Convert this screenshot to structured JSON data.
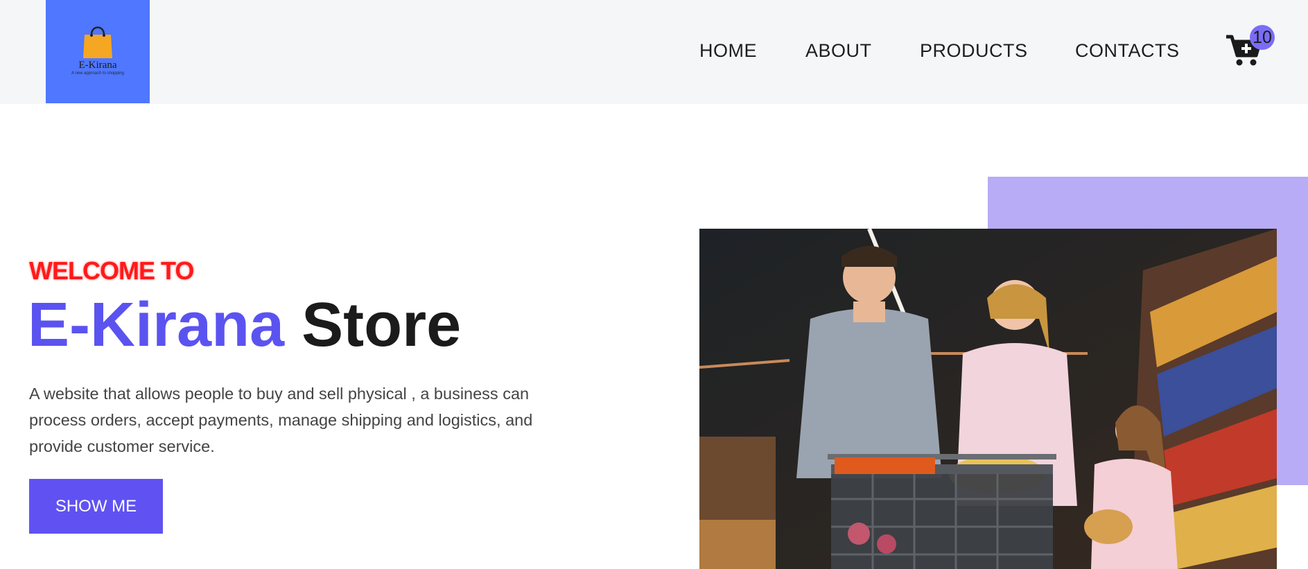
{
  "header": {
    "logo": {
      "name": "E-Kirana",
      "tagline": "A new approach to shopping",
      "bag_color": "#f5a623"
    },
    "nav": [
      {
        "label": "HOME"
      },
      {
        "label": "ABOUT"
      },
      {
        "label": "PRODUCTS"
      },
      {
        "label": "CONTACTS"
      }
    ],
    "cart": {
      "icon": "cart-plus-icon",
      "count": "10"
    }
  },
  "hero": {
    "welcome": "WELCOME TO",
    "title_brand": "E-Kirana",
    "title_rest": "Store",
    "description": "A website that allows people to buy and sell physical , a business can process orders, accept payments, manage shipping and logistics, and provide customer service.",
    "button_label": "SHOW ME"
  },
  "colors": {
    "accent": "#6052f2",
    "brand_text": "#5b53f0",
    "welcome_red": "#ff1a1a",
    "accent_box": "#b7acf5",
    "logo_bg": "#4f77ff"
  }
}
